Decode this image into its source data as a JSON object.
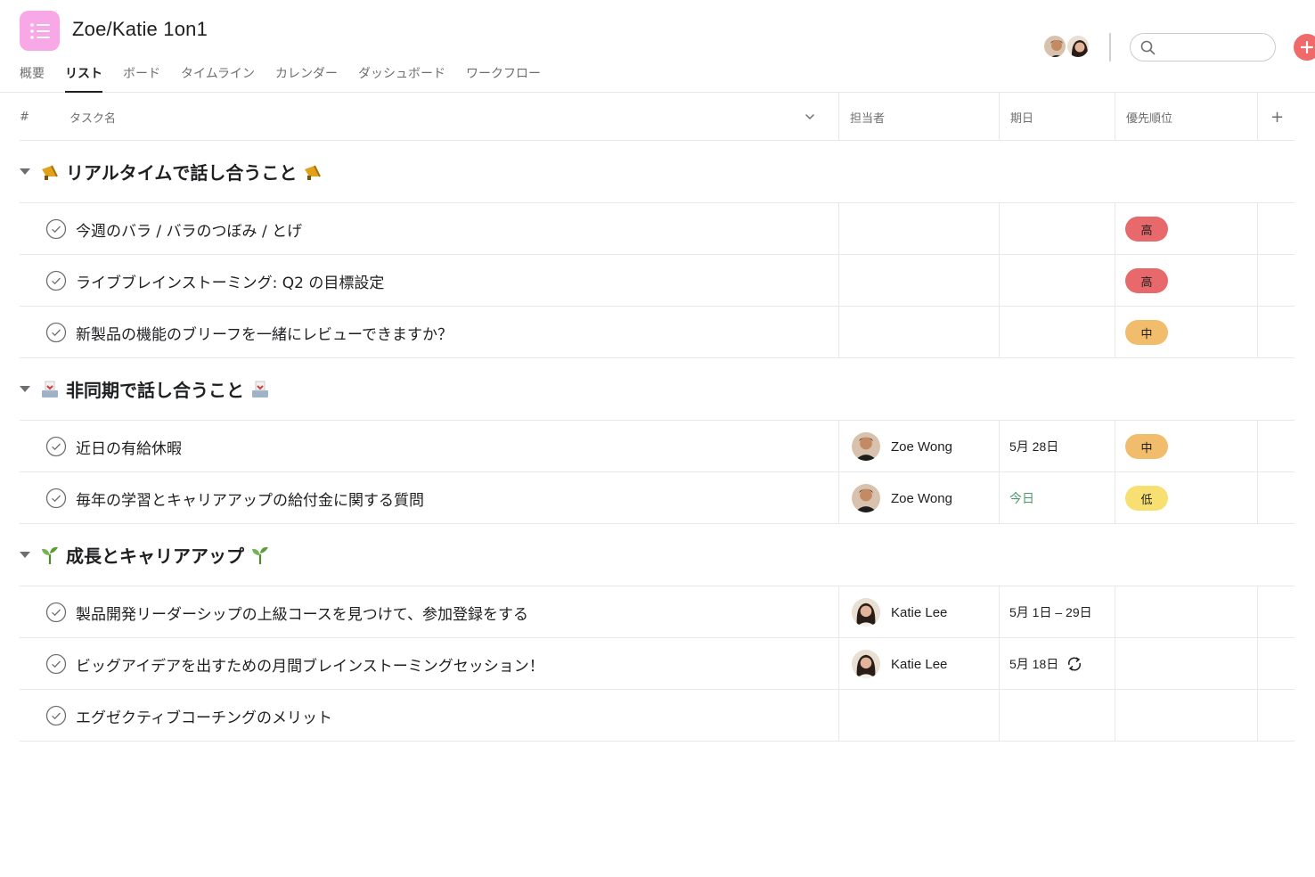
{
  "header": {
    "title": "Zoe/Katie 1on1",
    "tabs": [
      {
        "label": "概要",
        "active": false
      },
      {
        "label": "リスト",
        "active": true
      },
      {
        "label": "ボード",
        "active": false
      },
      {
        "label": "タイムライン",
        "active": false
      },
      {
        "label": "カレンダー",
        "active": false
      },
      {
        "label": "ダッシュボード",
        "active": false
      },
      {
        "label": "ワークフロー",
        "active": false
      }
    ],
    "search_placeholder": "",
    "app_icon": "list-icon"
  },
  "columns": {
    "num": "#",
    "task": "タスク名",
    "assignee": "担当者",
    "due": "期日",
    "priority": "優先順位",
    "add": "+"
  },
  "colors": {
    "accent": "#f06a6a",
    "app_icon_bg": "#f8a8e6",
    "priority_high": "#e8696b",
    "priority_medium": "#f1bd6c",
    "priority_low": "#f8df72",
    "today": "#4a9b6a"
  },
  "sections": [
    {
      "title": "リアルタイムで話し合うこと",
      "icon": "megaphone-emoji",
      "tasks": [
        {
          "name": "今週のバラ / バラのつぼみ / とげ",
          "assignee": "",
          "due": "",
          "priority": "高"
        },
        {
          "name": "ライブブレインストーミング: Q2 の目標設定",
          "assignee": "",
          "due": "",
          "priority": "高"
        },
        {
          "name": "新製品の機能のブリーフを一緒にレビューできますか？",
          "assignee": "",
          "due": "",
          "priority": "中"
        }
      ]
    },
    {
      "title": "非同期で話し合うこと",
      "icon": "inbox-tray-emoji",
      "tasks": [
        {
          "name": "近日の有給休暇",
          "assignee": "Zoe Wong",
          "due": "5月 28日",
          "priority": "中"
        },
        {
          "name": "毎年の学習とキャリアアップの給付金に関する質問",
          "assignee": "Zoe Wong",
          "due": "今日",
          "priority": "低"
        }
      ]
    },
    {
      "title": "成長とキャリアアップ",
      "icon": "seedling-emoji",
      "tasks": [
        {
          "name": "製品開発リーダーシップの上級コースを見つけて、参加登録をする",
          "assignee": "Katie Lee",
          "due": "5月 1日 – 29日",
          "priority": ""
        },
        {
          "name": "ビッグアイデアを出すための月間ブレインストーミングセッション！",
          "assignee": "Katie Lee",
          "due": "5月 18日",
          "priority": "",
          "recurring": true
        },
        {
          "name": "エグゼクティブコーチングのメリット",
          "assignee": "",
          "due": "",
          "priority": ""
        }
      ]
    }
  ]
}
